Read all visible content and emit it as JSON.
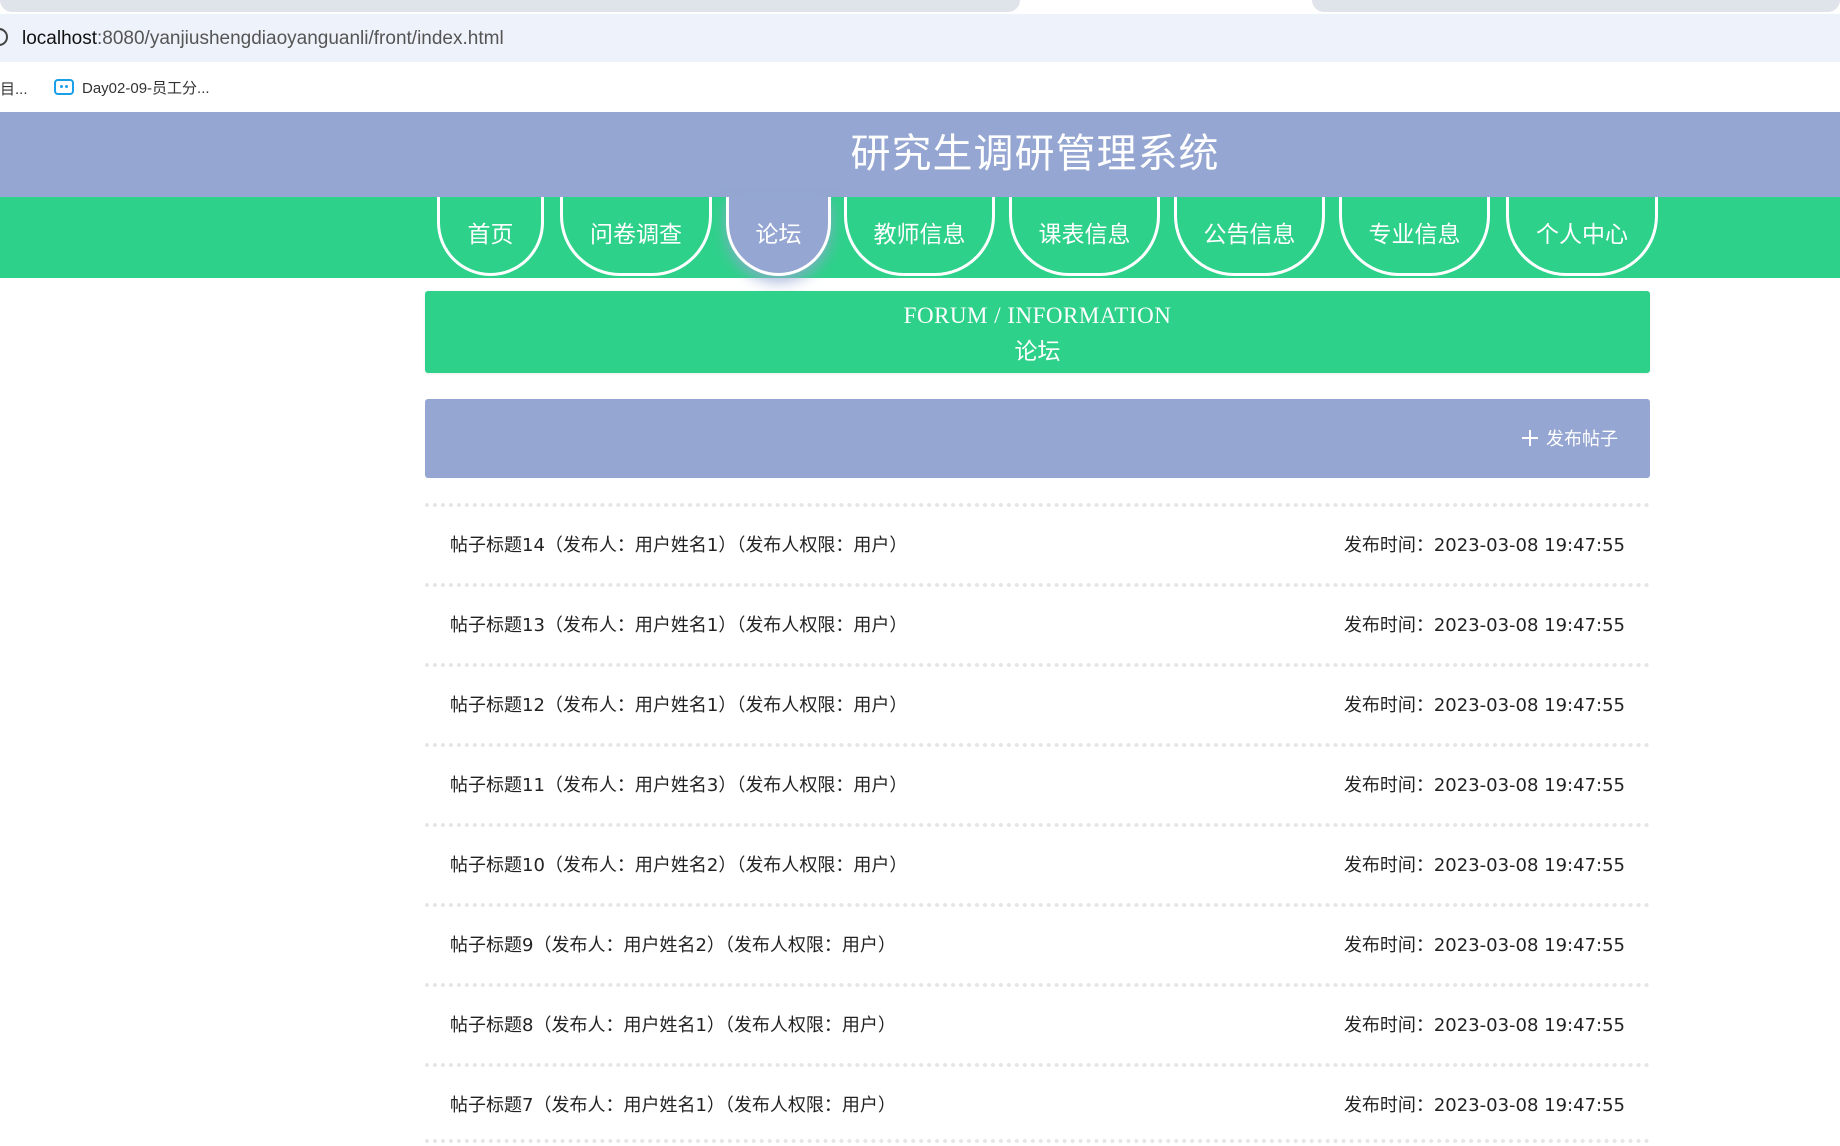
{
  "browser": {
    "url_host": "localhost",
    "url_rest": ":8080/yanjiushengdiaoyanguanli/front/index.html",
    "bookmark_truncated": "目...",
    "bookmark_label": "Day02-09-员工分..."
  },
  "site": {
    "title": "研究生调研管理系统"
  },
  "nav": {
    "items": [
      {
        "label": "首页"
      },
      {
        "label": "问卷调查"
      },
      {
        "label": "论坛"
      },
      {
        "label": "教师信息"
      },
      {
        "label": "课表信息"
      },
      {
        "label": "公告信息"
      },
      {
        "label": "专业信息"
      },
      {
        "label": "个人中心"
      }
    ],
    "active": "论坛"
  },
  "forum": {
    "banner_en": "FORUM / INFORMATION",
    "banner_cn": "论坛",
    "post_button_label": "发布帖子"
  },
  "posts": [
    {
      "title": "帖子标题14（发布人：用户姓名1）（发布人权限：用户）",
      "time": "发布时间：2023-03-08 19:47:55"
    },
    {
      "title": "帖子标题13（发布人：用户姓名1）（发布人权限：用户）",
      "time": "发布时间：2023-03-08 19:47:55"
    },
    {
      "title": "帖子标题12（发布人：用户姓名1）（发布人权限：用户）",
      "time": "发布时间：2023-03-08 19:47:55"
    },
    {
      "title": "帖子标题11（发布人：用户姓名3）（发布人权限：用户）",
      "time": "发布时间：2023-03-08 19:47:55"
    },
    {
      "title": "帖子标题10（发布人：用户姓名2）（发布人权限：用户）",
      "time": "发布时间：2023-03-08 19:47:55"
    },
    {
      "title": "帖子标题9（发布人：用户姓名2）（发布人权限：用户）",
      "time": "发布时间：2023-03-08 19:47:55"
    },
    {
      "title": "帖子标题8（发布人：用户姓名1）（发布人权限：用户）",
      "time": "发布时间：2023-03-08 19:47:55"
    },
    {
      "title": "帖子标题7（发布人：用户姓名1）（发布人权限：用户）",
      "time": "发布时间：2023-03-08 19:47:55"
    }
  ],
  "colors": {
    "header_bg": "#94a6d1",
    "accent_green": "#2ed18a",
    "address_bar_bg": "#eef2fa"
  }
}
